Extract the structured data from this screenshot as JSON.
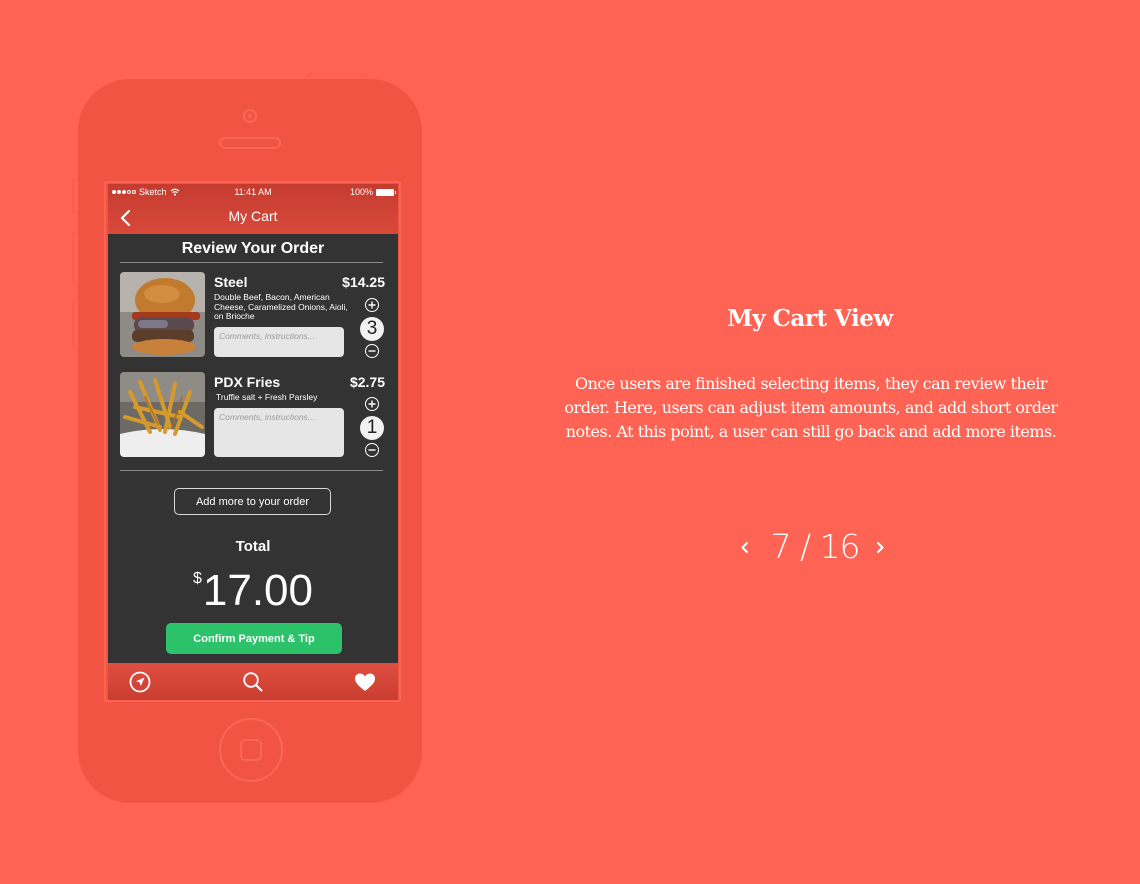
{
  "colors": {
    "background": "#ff6353",
    "phone_body": "#f25443",
    "navbar": "#d0433a",
    "screen_bg": "#333333",
    "confirm_green": "#2cc26a"
  },
  "phone": {
    "status_bar": {
      "carrier": "Sketch",
      "time": "11:41 AM",
      "battery": "100%",
      "signal_dots_filled": 3,
      "signal_dots_total": 5
    },
    "navbar": {
      "title": "My Cart",
      "back_icon": "chevron-left-icon"
    },
    "section_title": "Review Your Order",
    "items": [
      {
        "name": "Steel",
        "price": "$14.25",
        "description": "Double Beef, Bacon, American Cheese, Caramelized Onions, Aioli, on Brioche",
        "comment_placeholder": "Comments, instructions...",
        "quantity": "3",
        "image": "burger-photo"
      },
      {
        "name": "PDX Fries",
        "price": "$2.75",
        "description": "Truffle salt + Fresh Parsley",
        "comment_placeholder": "Comments, instructions...",
        "quantity": "1",
        "image": "fries-photo"
      }
    ],
    "add_more_label": "Add more to your order",
    "total_label": "Total",
    "total_currency": "$",
    "total_amount": "17.00",
    "confirm_label": "Confirm Payment & Tip",
    "tabbar": [
      {
        "icon": "compass-icon",
        "label": "Explore"
      },
      {
        "icon": "search-icon",
        "label": "Search"
      },
      {
        "icon": "heart-icon",
        "label": "Favorites"
      }
    ]
  },
  "description": {
    "title": "My Cart View",
    "body": "Once users are finished selecting items, they can review their order. Here, users can adjust item amounts, and add short order notes. At this point, a user can still go back and add more items."
  },
  "pager": {
    "current": "7",
    "total": "16",
    "label": "7 / 16"
  }
}
